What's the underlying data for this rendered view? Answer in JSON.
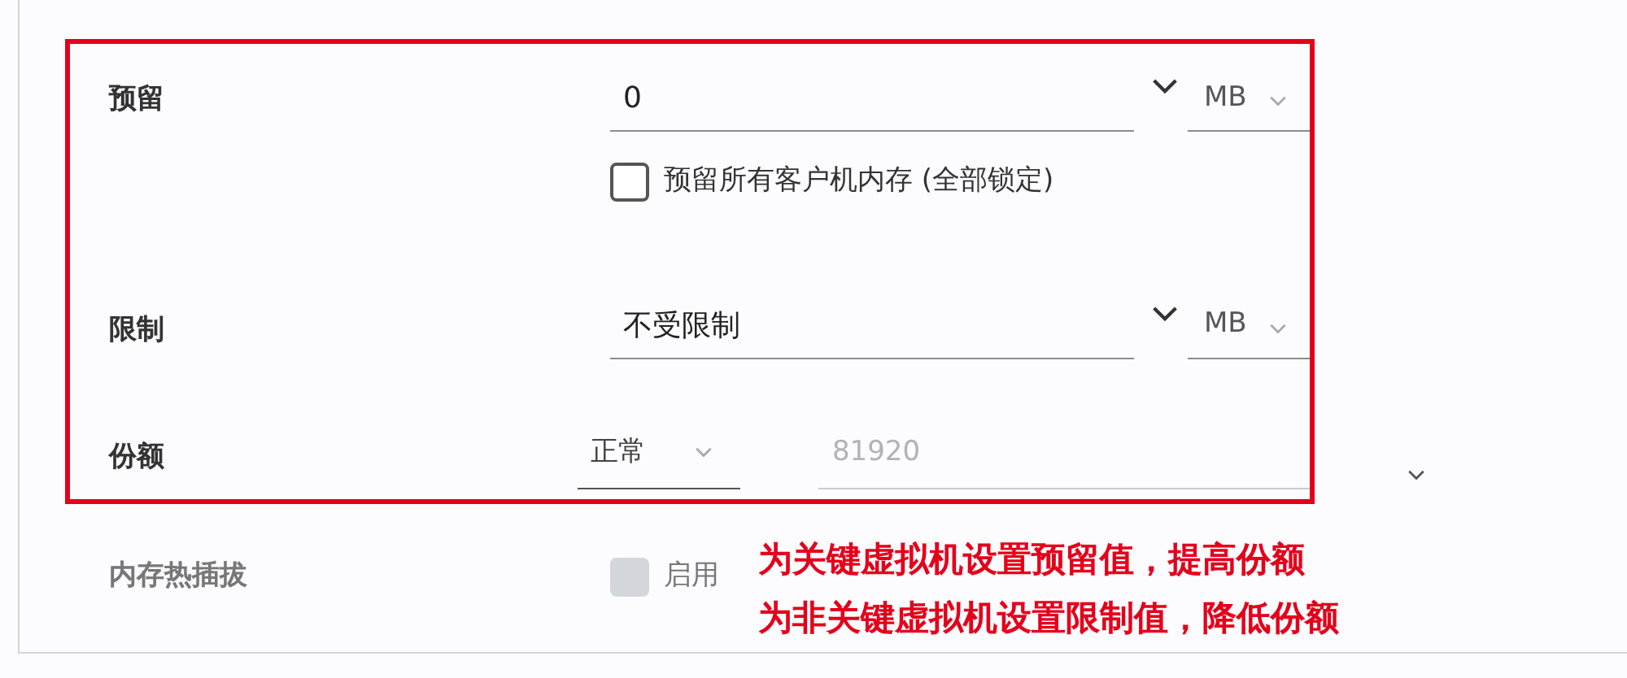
{
  "reservation": {
    "label": "预留",
    "value": "0",
    "unit": "MB",
    "reserve_all": {
      "label": "预留所有客户机内存 (全部锁定)",
      "checked": false
    }
  },
  "limit": {
    "label": "限制",
    "value": "不受限制",
    "unit": "MB"
  },
  "shares": {
    "label": "份额",
    "option": "正常",
    "value": "81920",
    "disabled": true
  },
  "hot_plug": {
    "label": "内存热插拔",
    "option": {
      "label": "启用",
      "checked": false,
      "disabled": true
    }
  },
  "annotation": {
    "lines": [
      "为关键虚拟机设置预留值，提高份额",
      "为非关键虚拟机设置限制值，降低份额"
    ]
  }
}
